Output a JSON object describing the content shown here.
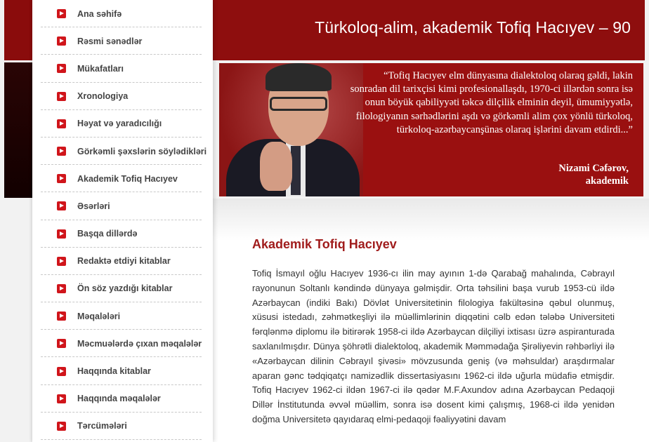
{
  "header": {
    "site_title": "Türkoloq-alim, akademik Tofiq Hacıyev – 90"
  },
  "banner": {
    "quote": "“Tofiq Hacıyev elm dünyasına dialektoloq olaraq gəldi, lakin sonradan dil tarixçisi kimi profesionallaşdı, 1970-ci illərdən sonra isə onun böyük qabiliyyəti təkcə dilçilik elminin deyil, ümumiyyətlə, filologiyanın sərhədlərini aşdı və görkəmli alim çox yönlü türkoloq, türkoloq-azərbaycanşünas olaraq işlərini davam etdirdi...”",
    "author_name": "Nizami Cəfərov,",
    "author_title": "akademik"
  },
  "sidebar": {
    "items": [
      {
        "label": "Ana səhifə"
      },
      {
        "label": "Rəsmi sənədlər"
      },
      {
        "label": "Mükafatları"
      },
      {
        "label": "Xronologiya"
      },
      {
        "label": "Həyat və yaradıcılığı"
      },
      {
        "label": "Görkəmli şəxslərin söylədikləri"
      },
      {
        "label": "Akademik Tofiq Hacıyev"
      },
      {
        "label": "Əsərləri"
      },
      {
        "label": "Başqa dillərdə"
      },
      {
        "label": "Redaktə etdiyi kitablar"
      },
      {
        "label": "Ön söz yazdığı kitablar"
      },
      {
        "label": "Məqalələri"
      },
      {
        "label": "Məcmuələrdə çıxan məqalələr"
      },
      {
        "label": "Haqqında kitablar"
      },
      {
        "label": "Haqqında məqalələr"
      },
      {
        "label": "Tərcümələri"
      }
    ]
  },
  "article": {
    "title": "Akademik Tofiq Hacıyev",
    "body": "Tofiq İsmayıl oğlu Hacıyev 1936-cı ilin may ayının 1-də Qarabağ mahalında, Cəbrayıl rayonunun Soltanlı kəndində dünyaya gəlmişdir. Orta təhsilini başa vurub 1953-cü ildə Azərbaycan (indiki Bakı) Dövlət Universitetinin filologiya fakültəsinə qəbul olunmuş, xüsusi istedadı, zəhmətkeşliyi ilə müəllimlərinin diqqətini cəlb edən tələbə Universiteti fərqlənmə diplomu ilə bitirərək 1958-ci ildə Azərbaycan dilçiliyi ixtisası üzrə aspiranturada saxlanılmışdır. Dünya şöhrətli dialektoloq, akademik Məmmədağa Şirəliyevin rəhbərliyi ilə «Azərbaycan dilinin Cəbrayıl şivəsi» mövzusunda geniş (və məhsuldar) araşdırmalar aparan gənc tədqiqatçı namizədlik dissertasiyasını 1962-ci ildə uğurla müdafiə etmişdir. Tofiq Hacıyev 1962-ci ildən 1967-ci ilə qədər M.F.Axundov adına Azərbaycan Pedaqoji Dillər İnstitutunda əvvəl müəllim, sonra isə dosent kimi çalışmış, 1968-ci ildə yenidən doğma Universitetə qayıdaraq elmi-pedaqoji fəaliyyətini davam"
  },
  "colors": {
    "header_red": "#8e0e0e",
    "banner_red": "#9a1010",
    "icon_red": "#d0151b",
    "title_red": "#a01c1c"
  }
}
